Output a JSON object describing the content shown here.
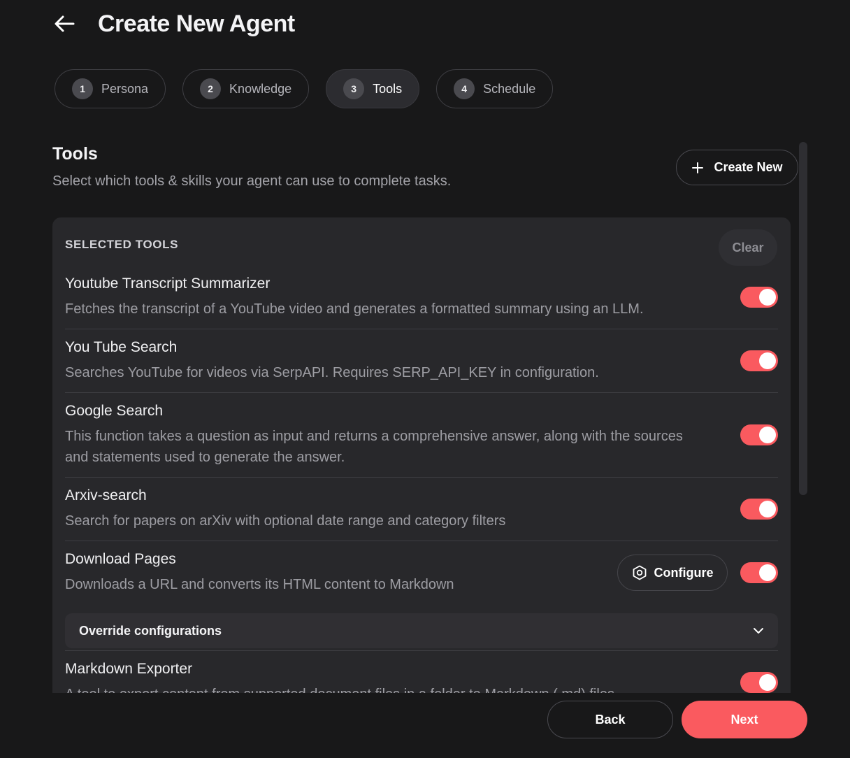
{
  "header": {
    "title": "Create New Agent"
  },
  "steps": [
    {
      "num": "1",
      "label": "Persona"
    },
    {
      "num": "2",
      "label": "Knowledge"
    },
    {
      "num": "3",
      "label": "Tools",
      "active": true
    },
    {
      "num": "4",
      "label": "Schedule"
    }
  ],
  "section": {
    "title": "Tools",
    "subtitle": "Select which tools & skills your agent can use to complete tasks.",
    "create_new_label": "Create New"
  },
  "panel": {
    "label": "SELECTED TOOLS",
    "clear_label": "Clear",
    "tools": [
      {
        "name": "Youtube Transcript Summarizer",
        "description": "Fetches the transcript of a YouTube video and generates a formatted summary using an LLM.",
        "enabled": true
      },
      {
        "name": "You Tube Search",
        "description": "Searches YouTube for videos via SerpAPI. Requires SERP_API_KEY in configuration.",
        "enabled": true
      },
      {
        "name": "Google Search",
        "description": "This function takes a question as input and returns a comprehensive answer, along with the sources and statements used to generate the answer.",
        "enabled": true
      },
      {
        "name": "Arxiv-search",
        "description": "Search for papers on arXiv with optional date range and category filters",
        "enabled": true
      },
      {
        "name": "Download Pages",
        "description": "Downloads a URL and converts its HTML content to Markdown",
        "enabled": true,
        "configure_label": "Configure"
      },
      {
        "name": "Markdown Exporter",
        "description": "A tool to export content from supported document files in a folder to Markdown (.md) files",
        "enabled": true
      }
    ],
    "override_label": "Override configurations"
  },
  "footer": {
    "back_label": "Back",
    "next_label": "Next"
  },
  "colors": {
    "accent": "#fa5a5f",
    "background": "#181819",
    "panel": "#28282b"
  }
}
